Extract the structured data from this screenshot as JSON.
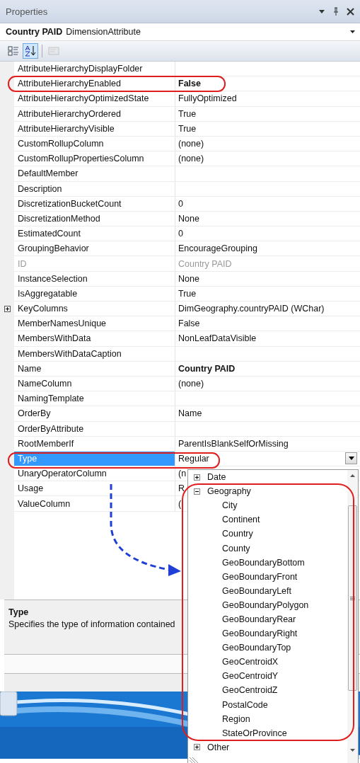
{
  "window": {
    "title": "Properties"
  },
  "object": {
    "name": "Country PAID",
    "type": "DimensionAttribute"
  },
  "toolbar": [
    {
      "kind": "categorized",
      "selected": false,
      "disabled": false
    },
    {
      "kind": "alphabetical",
      "selected": true,
      "disabled": false
    },
    {
      "kind": "property-pages",
      "selected": false,
      "disabled": true
    }
  ],
  "rows": [
    {
      "name": "AttributeHierarchyDisplayFolder",
      "value": "",
      "kind": "text",
      "disabled": false,
      "selected": false
    },
    {
      "name": "AttributeHierarchyEnabled",
      "value": "False",
      "kind": "text",
      "bold": true,
      "disabled": false,
      "selected": false
    },
    {
      "name": "AttributeHierarchyOptimizedState",
      "value": "FullyOptimized",
      "kind": "text",
      "bold": false,
      "disabled": false,
      "selected": false
    },
    {
      "name": "AttributeHierarchyOrdered",
      "value": "True",
      "kind": "text",
      "bold": false,
      "disabled": false,
      "selected": false
    },
    {
      "name": "AttributeHierarchyVisible",
      "value": "True",
      "kind": "text",
      "bold": false,
      "disabled": false,
      "selected": false
    },
    {
      "name": "CustomRollupColumn",
      "value": "(none)",
      "kind": "text",
      "bold": false,
      "disabled": false,
      "selected": false
    },
    {
      "name": "CustomRollupPropertiesColumn",
      "value": "(none)",
      "kind": "text",
      "bold": false,
      "disabled": false,
      "selected": false
    },
    {
      "name": "DefaultMember",
      "value": "",
      "kind": "text",
      "disabled": false,
      "selected": false
    },
    {
      "name": "Description",
      "value": "",
      "kind": "text",
      "disabled": false,
      "selected": false
    },
    {
      "name": "DiscretizationBucketCount",
      "value": "0",
      "kind": "text",
      "bold": false,
      "disabled": false,
      "selected": false
    },
    {
      "name": "DiscretizationMethod",
      "value": "None",
      "kind": "text",
      "bold": false,
      "disabled": false,
      "selected": false
    },
    {
      "name": "EstimatedCount",
      "value": "0",
      "kind": "text",
      "bold": false,
      "disabled": false,
      "selected": false
    },
    {
      "name": "GroupingBehavior",
      "value": "EncourageGrouping",
      "kind": "text",
      "bold": false,
      "disabled": false,
      "selected": false
    },
    {
      "name": "ID",
      "value": "Country PAID",
      "kind": "text",
      "bold": false,
      "disabled": true,
      "selected": false
    },
    {
      "name": "InstanceSelection",
      "value": "None",
      "kind": "text",
      "bold": false,
      "disabled": false,
      "selected": false
    },
    {
      "name": "IsAggregatable",
      "value": "True",
      "kind": "text",
      "bold": false,
      "disabled": false,
      "selected": false
    },
    {
      "name": "KeyColumns",
      "value": "DimGeography.countryPAID (WChar)",
      "kind": "group",
      "expanded": false,
      "bold": false,
      "disabled": false,
      "selected": false
    },
    {
      "name": "MemberNamesUnique",
      "value": "False",
      "kind": "text",
      "bold": false,
      "disabled": false,
      "selected": false
    },
    {
      "name": "MembersWithData",
      "value": "NonLeafDataVisible",
      "kind": "text",
      "bold": false,
      "disabled": false,
      "selected": false
    },
    {
      "name": "MembersWithDataCaption",
      "value": "",
      "kind": "text",
      "disabled": false,
      "selected": false
    },
    {
      "name": "Name",
      "value": "Country PAID",
      "kind": "text",
      "bold": true,
      "disabled": false,
      "selected": false
    },
    {
      "name": "NameColumn",
      "value": "(none)",
      "kind": "text",
      "bold": false,
      "disabled": false,
      "selected": false
    },
    {
      "name": "NamingTemplate",
      "value": "",
      "kind": "text",
      "disabled": false,
      "selected": false
    },
    {
      "name": "OrderBy",
      "value": "Name",
      "kind": "text",
      "bold": false,
      "disabled": false,
      "selected": false
    },
    {
      "name": "OrderByAttribute",
      "value": "",
      "kind": "text",
      "disabled": false,
      "selected": false
    },
    {
      "name": "RootMemberIf",
      "value": "ParentIsBlankSelfOrMissing",
      "kind": "text",
      "bold": false,
      "disabled": false,
      "selected": false
    },
    {
      "name": "Type",
      "value": "Regular",
      "kind": "dropdown",
      "bold": false,
      "disabled": false,
      "selected": true
    },
    {
      "name": "UnaryOperatorColumn",
      "value": "(n",
      "kind": "text",
      "bold": false,
      "disabled": false,
      "selected": false
    },
    {
      "name": "Usage",
      "value": "R",
      "kind": "text",
      "bold": false,
      "disabled": false,
      "selected": false
    },
    {
      "name": "ValueColumn",
      "value": "(",
      "kind": "text",
      "bold": false,
      "disabled": false,
      "selected": false
    }
  ],
  "description": {
    "title": "Type",
    "text": "Specifies the type of information contained"
  },
  "dropdown": {
    "items": [
      {
        "label": "Date",
        "expanded": false
      },
      {
        "label": "Geography",
        "expanded": true,
        "children": [
          {
            "label": "City"
          },
          {
            "label": "Continent"
          },
          {
            "label": "Country"
          },
          {
            "label": "County"
          },
          {
            "label": "GeoBoundaryBottom"
          },
          {
            "label": "GeoBoundaryFront"
          },
          {
            "label": "GeoBoundaryLeft"
          },
          {
            "label": "GeoBoundaryPolygon"
          },
          {
            "label": "GeoBoundaryRear"
          },
          {
            "label": "GeoBoundaryRight"
          },
          {
            "label": "GeoBoundaryTop"
          },
          {
            "label": "GeoCentroidX"
          },
          {
            "label": "GeoCentroidY"
          },
          {
            "label": "GeoCentroidZ"
          },
          {
            "label": "PostalCode"
          },
          {
            "label": "Region"
          },
          {
            "label": "StateOrProvince"
          }
        ]
      },
      {
        "label": "Other",
        "expanded": false
      }
    ]
  }
}
